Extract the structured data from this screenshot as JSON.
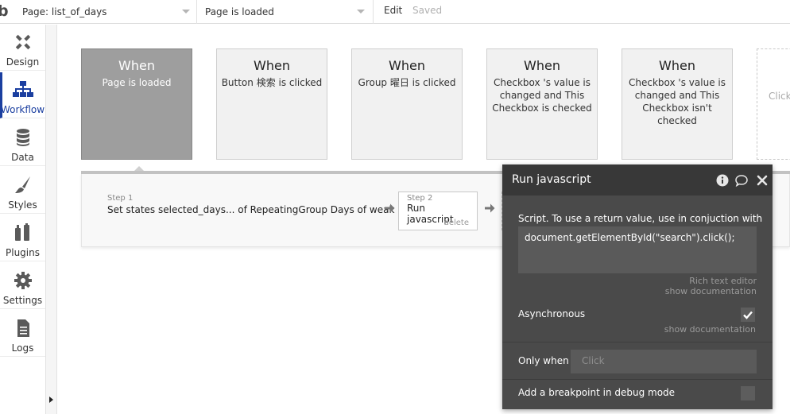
{
  "topbar": {
    "logo": "b",
    "page_select": "Page: list_of_days",
    "event_select": "Page is loaded",
    "edit": "Edit",
    "saved": "Saved"
  },
  "sidebar": {
    "items": [
      {
        "label": "Design",
        "icon": "design-icon"
      },
      {
        "label": "Workflow",
        "icon": "workflow-icon",
        "active": true
      },
      {
        "label": "Data",
        "icon": "data-icon"
      },
      {
        "label": "Styles",
        "icon": "styles-icon"
      },
      {
        "label": "Plugins",
        "icon": "plugins-icon"
      },
      {
        "label": "Settings",
        "icon": "settings-icon"
      },
      {
        "label": "Logs",
        "icon": "logs-icon"
      }
    ]
  },
  "events": [
    {
      "when": "When",
      "desc": "Page is loaded",
      "active": true
    },
    {
      "when": "When",
      "desc": "Button 検索 is clicked"
    },
    {
      "when": "When",
      "desc": "Group 曜日 is clicked"
    },
    {
      "when": "When",
      "desc": "Checkbox 's value is changed and This Checkbox is checked"
    },
    {
      "when": "When",
      "desc": "Checkbox 's value is changed and This Checkbox isn't checked"
    }
  ],
  "add_event": "Click",
  "actions": {
    "step1": {
      "num": "Step 1",
      "title": "Set states selected_days... of RepeatingGroup Days of weak"
    },
    "step2": {
      "num": "Step 2",
      "title": "Run javascript",
      "delete": "delete"
    }
  },
  "panel": {
    "title": "Run javascript",
    "script_label": "Script. To use a return value, use in conjuction with",
    "script_value": "document.getElementById(\"search\").click();",
    "rich_text": "Rich text editor",
    "show_doc_1": "show documentation",
    "async_label": "Asynchronous",
    "async_checked": true,
    "show_doc_2": "show documentation",
    "only_when_label": "Only when",
    "only_when_placeholder": "Click",
    "breakpoint_label": "Add a breakpoint in debug mode",
    "breakpoint_checked": false
  }
}
